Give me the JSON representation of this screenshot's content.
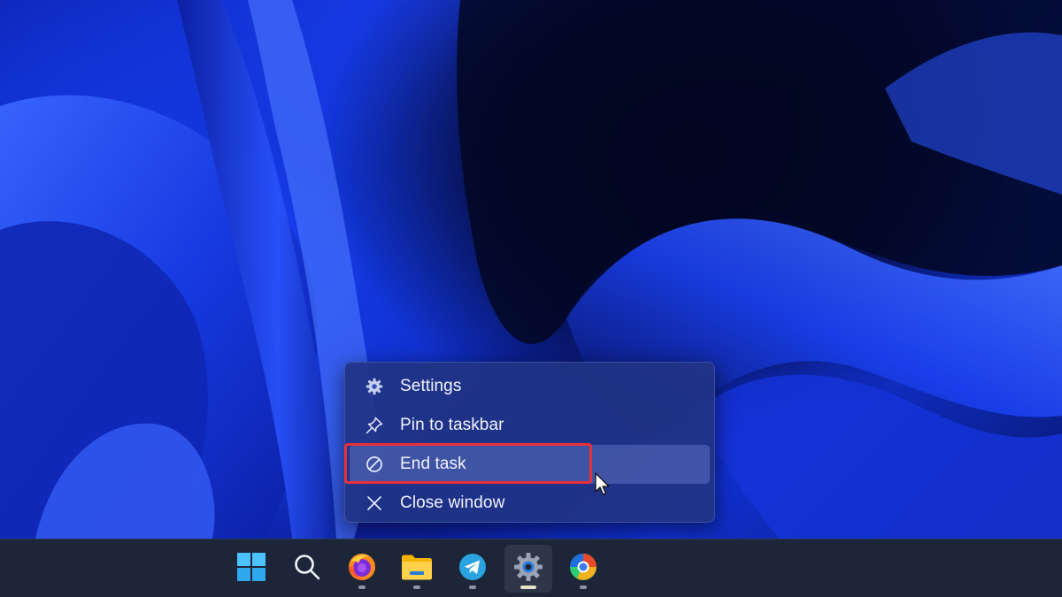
{
  "context_menu": {
    "items": [
      {
        "label": "Settings",
        "icon": "gear-icon"
      },
      {
        "label": "Pin to taskbar",
        "icon": "pin-icon"
      },
      {
        "label": "End task",
        "icon": "prohibited-icon",
        "hovered": true,
        "highlighted": true
      },
      {
        "label": "Close window",
        "icon": "close-icon"
      }
    ]
  },
  "taskbar": {
    "apps": [
      {
        "name": "start",
        "icon": "windows-logo-icon"
      },
      {
        "name": "search",
        "icon": "search-icon"
      },
      {
        "name": "firefox",
        "icon": "firefox-icon",
        "running": true
      },
      {
        "name": "file-explorer",
        "icon": "folder-icon",
        "running": true
      },
      {
        "name": "telegram",
        "icon": "telegram-icon",
        "running": true
      },
      {
        "name": "settings",
        "icon": "gear-icon",
        "running": true,
        "active": true
      },
      {
        "name": "browser",
        "icon": "browser-icon",
        "running": true
      }
    ]
  },
  "colors": {
    "highlight_border": "#e8303a",
    "menu_background": "#203484",
    "taskbar_background": "#1c2638"
  }
}
